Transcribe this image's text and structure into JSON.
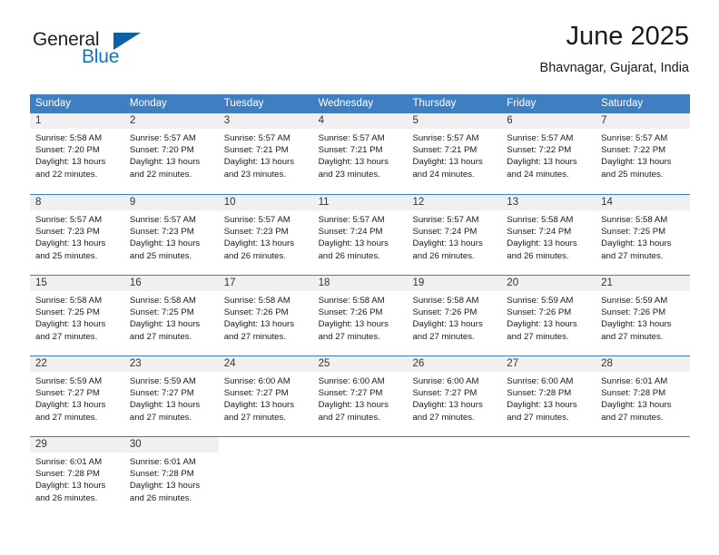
{
  "logo": {
    "word_one": "General",
    "word_two": "Blue",
    "triangle_icon": "triangle-icon",
    "accent_color": "#0b62a8",
    "text_color": "#231f20"
  },
  "header": {
    "title": "June 2025",
    "location": "Bhavnagar, Gujarat, India"
  },
  "theme": {
    "header_band": "#3f7fc1",
    "day_band": "#f0f0f0",
    "text": "#1a1a1a"
  },
  "calendar": {
    "day_headers": [
      "Sunday",
      "Monday",
      "Tuesday",
      "Wednesday",
      "Thursday",
      "Friday",
      "Saturday"
    ],
    "weeks": [
      [
        {
          "day": "1",
          "lines": [
            "Sunrise: 5:58 AM",
            "Sunset: 7:20 PM",
            "Daylight: 13 hours",
            "and 22 minutes."
          ]
        },
        {
          "day": "2",
          "lines": [
            "Sunrise: 5:57 AM",
            "Sunset: 7:20 PM",
            "Daylight: 13 hours",
            "and 22 minutes."
          ]
        },
        {
          "day": "3",
          "lines": [
            "Sunrise: 5:57 AM",
            "Sunset: 7:21 PM",
            "Daylight: 13 hours",
            "and 23 minutes."
          ]
        },
        {
          "day": "4",
          "lines": [
            "Sunrise: 5:57 AM",
            "Sunset: 7:21 PM",
            "Daylight: 13 hours",
            "and 23 minutes."
          ]
        },
        {
          "day": "5",
          "lines": [
            "Sunrise: 5:57 AM",
            "Sunset: 7:21 PM",
            "Daylight: 13 hours",
            "and 24 minutes."
          ]
        },
        {
          "day": "6",
          "lines": [
            "Sunrise: 5:57 AM",
            "Sunset: 7:22 PM",
            "Daylight: 13 hours",
            "and 24 minutes."
          ]
        },
        {
          "day": "7",
          "lines": [
            "Sunrise: 5:57 AM",
            "Sunset: 7:22 PM",
            "Daylight: 13 hours",
            "and 25 minutes."
          ]
        }
      ],
      [
        {
          "day": "8",
          "lines": [
            "Sunrise: 5:57 AM",
            "Sunset: 7:23 PM",
            "Daylight: 13 hours",
            "and 25 minutes."
          ]
        },
        {
          "day": "9",
          "lines": [
            "Sunrise: 5:57 AM",
            "Sunset: 7:23 PM",
            "Daylight: 13 hours",
            "and 25 minutes."
          ]
        },
        {
          "day": "10",
          "lines": [
            "Sunrise: 5:57 AM",
            "Sunset: 7:23 PM",
            "Daylight: 13 hours",
            "and 26 minutes."
          ]
        },
        {
          "day": "11",
          "lines": [
            "Sunrise: 5:57 AM",
            "Sunset: 7:24 PM",
            "Daylight: 13 hours",
            "and 26 minutes."
          ]
        },
        {
          "day": "12",
          "lines": [
            "Sunrise: 5:57 AM",
            "Sunset: 7:24 PM",
            "Daylight: 13 hours",
            "and 26 minutes."
          ]
        },
        {
          "day": "13",
          "lines": [
            "Sunrise: 5:58 AM",
            "Sunset: 7:24 PM",
            "Daylight: 13 hours",
            "and 26 minutes."
          ]
        },
        {
          "day": "14",
          "lines": [
            "Sunrise: 5:58 AM",
            "Sunset: 7:25 PM",
            "Daylight: 13 hours",
            "and 27 minutes."
          ]
        }
      ],
      [
        {
          "day": "15",
          "lines": [
            "Sunrise: 5:58 AM",
            "Sunset: 7:25 PM",
            "Daylight: 13 hours",
            "and 27 minutes."
          ]
        },
        {
          "day": "16",
          "lines": [
            "Sunrise: 5:58 AM",
            "Sunset: 7:25 PM",
            "Daylight: 13 hours",
            "and 27 minutes."
          ]
        },
        {
          "day": "17",
          "lines": [
            "Sunrise: 5:58 AM",
            "Sunset: 7:26 PM",
            "Daylight: 13 hours",
            "and 27 minutes."
          ]
        },
        {
          "day": "18",
          "lines": [
            "Sunrise: 5:58 AM",
            "Sunset: 7:26 PM",
            "Daylight: 13 hours",
            "and 27 minutes."
          ]
        },
        {
          "day": "19",
          "lines": [
            "Sunrise: 5:58 AM",
            "Sunset: 7:26 PM",
            "Daylight: 13 hours",
            "and 27 minutes."
          ]
        },
        {
          "day": "20",
          "lines": [
            "Sunrise: 5:59 AM",
            "Sunset: 7:26 PM",
            "Daylight: 13 hours",
            "and 27 minutes."
          ]
        },
        {
          "day": "21",
          "lines": [
            "Sunrise: 5:59 AM",
            "Sunset: 7:26 PM",
            "Daylight: 13 hours",
            "and 27 minutes."
          ]
        }
      ],
      [
        {
          "day": "22",
          "lines": [
            "Sunrise: 5:59 AM",
            "Sunset: 7:27 PM",
            "Daylight: 13 hours",
            "and 27 minutes."
          ]
        },
        {
          "day": "23",
          "lines": [
            "Sunrise: 5:59 AM",
            "Sunset: 7:27 PM",
            "Daylight: 13 hours",
            "and 27 minutes."
          ]
        },
        {
          "day": "24",
          "lines": [
            "Sunrise: 6:00 AM",
            "Sunset: 7:27 PM",
            "Daylight: 13 hours",
            "and 27 minutes."
          ]
        },
        {
          "day": "25",
          "lines": [
            "Sunrise: 6:00 AM",
            "Sunset: 7:27 PM",
            "Daylight: 13 hours",
            "and 27 minutes."
          ]
        },
        {
          "day": "26",
          "lines": [
            "Sunrise: 6:00 AM",
            "Sunset: 7:27 PM",
            "Daylight: 13 hours",
            "and 27 minutes."
          ]
        },
        {
          "day": "27",
          "lines": [
            "Sunrise: 6:00 AM",
            "Sunset: 7:28 PM",
            "Daylight: 13 hours",
            "and 27 minutes."
          ]
        },
        {
          "day": "28",
          "lines": [
            "Sunrise: 6:01 AM",
            "Sunset: 7:28 PM",
            "Daylight: 13 hours",
            "and 27 minutes."
          ]
        }
      ],
      [
        {
          "day": "29",
          "lines": [
            "Sunrise: 6:01 AM",
            "Sunset: 7:28 PM",
            "Daylight: 13 hours",
            "and 26 minutes."
          ]
        },
        {
          "day": "30",
          "lines": [
            "Sunrise: 6:01 AM",
            "Sunset: 7:28 PM",
            "Daylight: 13 hours",
            "and 26 minutes."
          ]
        },
        {
          "day": "",
          "lines": []
        },
        {
          "day": "",
          "lines": []
        },
        {
          "day": "",
          "lines": []
        },
        {
          "day": "",
          "lines": []
        },
        {
          "day": "",
          "lines": []
        }
      ]
    ]
  }
}
